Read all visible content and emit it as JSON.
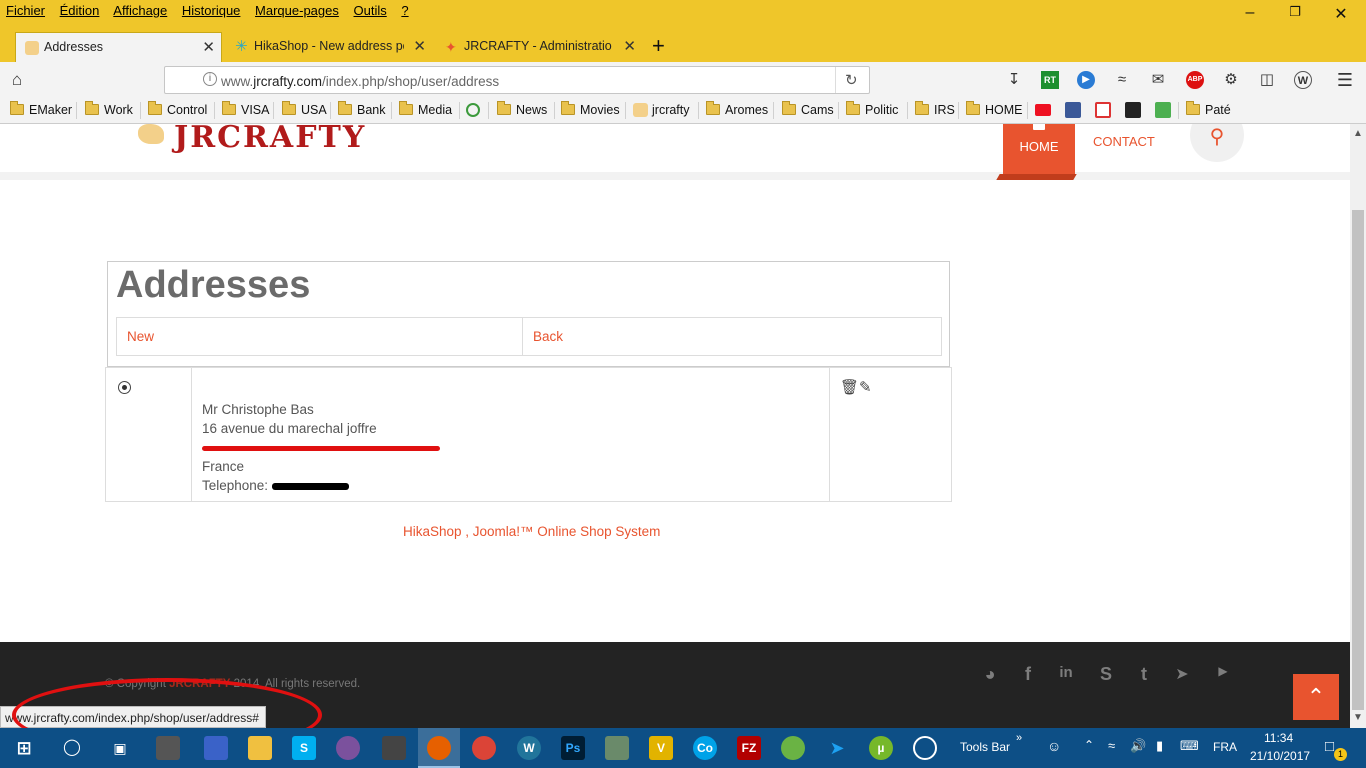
{
  "menubar": {
    "items": [
      "Fichier",
      "Édition",
      "Affichage",
      "Historique",
      "Marque-pages",
      "Outils",
      "?"
    ]
  },
  "tabs": [
    {
      "title": "Addresses",
      "active": true
    },
    {
      "title": "HikaShop - New address pop",
      "active": false
    },
    {
      "title": "JRCRAFTY - Administration",
      "active": false
    }
  ],
  "navbar": {
    "url_prefix": "www.",
    "url_domain": "jrcrafty.com",
    "url_path": "/index.php/shop/user/address"
  },
  "bookmarks": [
    "EMaker",
    "Work",
    "Control",
    "VISA",
    "USA",
    "Bank",
    "Media",
    "News",
    "Movies",
    "jrcrafty",
    "Aromes",
    "Cams",
    "Politic",
    "IRS",
    "HOME",
    "Paté"
  ],
  "site": {
    "logo": "JRCRAFTY",
    "nav_home": "HOME",
    "nav_contact": "CONTACT"
  },
  "addresses": {
    "title": "Addresses",
    "new_label": "New",
    "back_label": "Back",
    "entry": {
      "name": "Mr Christophe Bas",
      "street": "16 avenue du marechal joffre",
      "country": "France",
      "telephone_label": "Telephone:"
    }
  },
  "footer": {
    "powered_by": "HikaShop , Joomla!™ Online Shop System",
    "copyright_prefix": "© Copyright",
    "copyright_brand": "JRCRAFTY",
    "copyright_suffix": "2014. All rights reserved.",
    "social_icons": [
      "dribbble-icon",
      "facebook-icon",
      "linkedin-icon",
      "skype-icon",
      "tumblr-icon",
      "twitter-icon",
      "youtube-icon"
    ]
  },
  "status_bar": {
    "url": "www.jrcrafty.com/index.php/shop/user/address#"
  },
  "taskbar": {
    "tools_bar_label": "Tools Bar",
    "language": "FRA",
    "time": "11:34",
    "date": "21/10/2017",
    "notification_count": "1"
  },
  "colors": {
    "accent": "#e8542f",
    "firefox_theme": "#efc62a",
    "taskbar": "#0d4f86",
    "annotation": "#e01010"
  }
}
